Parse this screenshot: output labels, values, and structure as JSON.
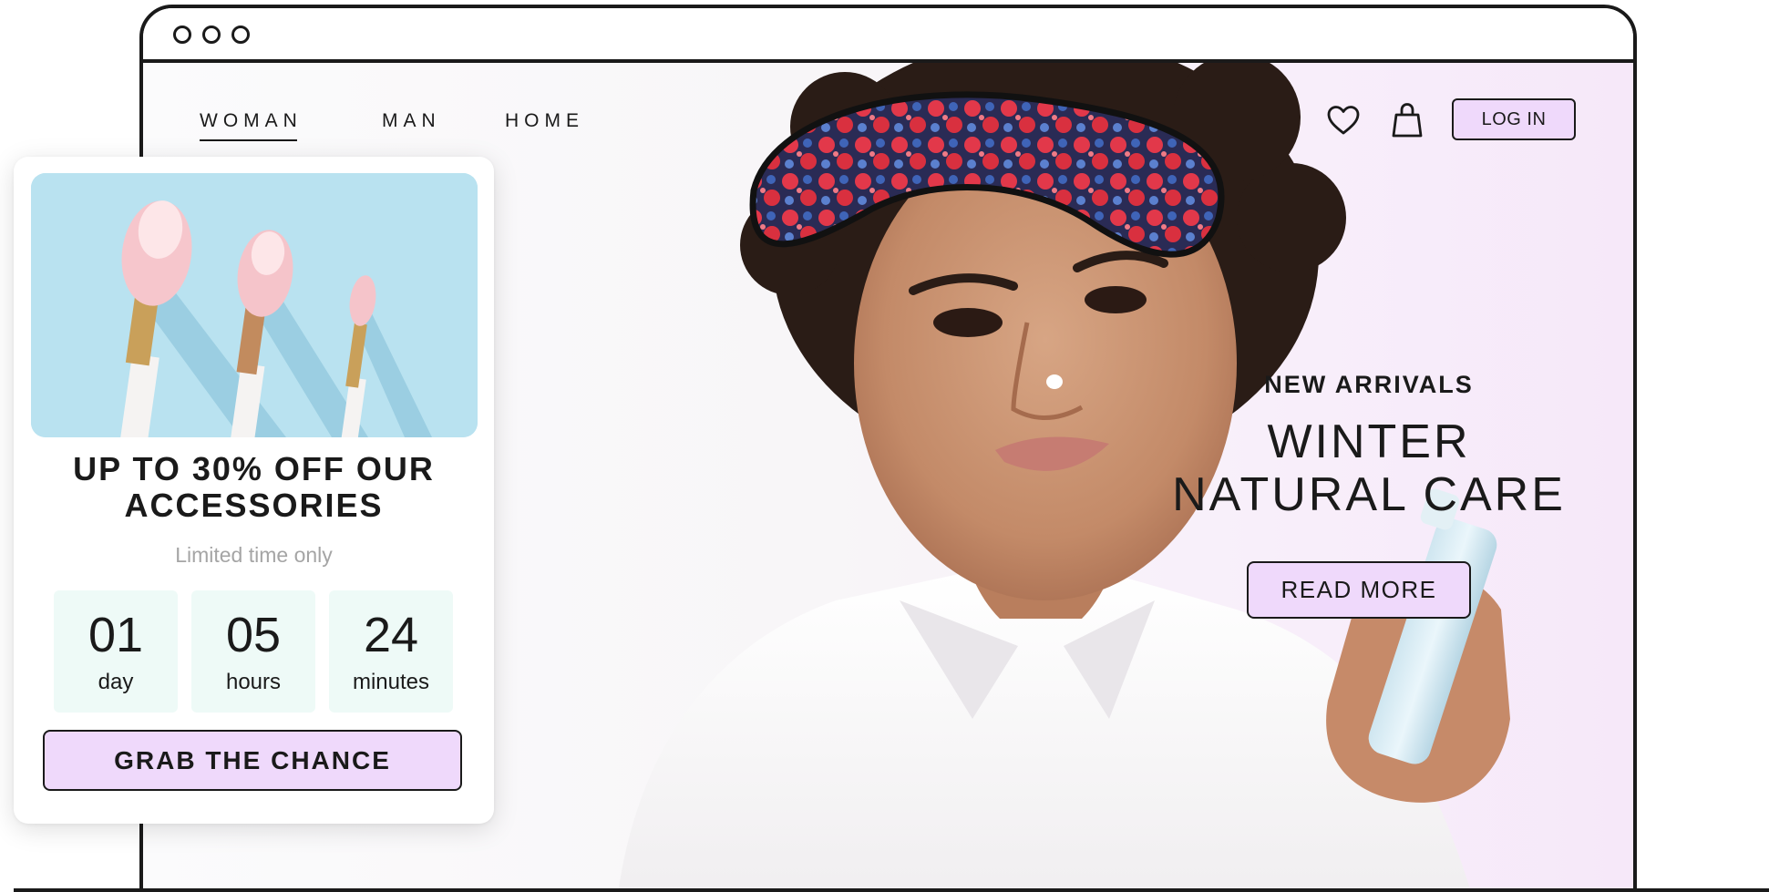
{
  "nav": {
    "links": [
      "WOMAN",
      "MAN",
      "HOME"
    ],
    "active": "WOMAN",
    "login_label": "LOG IN",
    "icons": [
      "heart-icon",
      "shopping-bag-icon"
    ]
  },
  "hero": {
    "eyebrow": "NEW ARRIVALS",
    "headline_line1": "WINTER",
    "headline_line2": "NATURAL CARE",
    "cta_label": "READ MORE",
    "image": "woman-with-berry-sleep-mask-photo"
  },
  "promo": {
    "image": "makeup-brushes-photo",
    "title_line1": "UP TO 30% OFF OUR",
    "title_line2": "ACCESSORIES",
    "subtitle": "Limited time only",
    "countdown": [
      {
        "value": "01",
        "unit": "day"
      },
      {
        "value": "05",
        "unit": "hours"
      },
      {
        "value": "24",
        "unit": "minutes"
      }
    ],
    "cta_label": "GRAB THE CHANCE"
  },
  "colors": {
    "accent_button": "#efd9fb",
    "countdown_bg": "#eefaf7",
    "outline": "#1a1a1a",
    "promo_image_bg": "#b9e2f0",
    "subtitle_gray": "#a5a5a5"
  }
}
